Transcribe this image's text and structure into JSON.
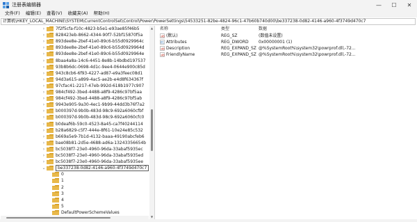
{
  "window": {
    "title": "注册表编辑器"
  },
  "window_controls": {
    "minimize": "—",
    "maximize": "☐",
    "close": "✕"
  },
  "menu": [
    "文件(F)",
    "编辑(E)",
    "查看(V)",
    "收藏夹(A)",
    "帮助(H)"
  ],
  "address": "计算机\\HKEY_LOCAL_MACHINE\\SYSTEM\\CurrentControlSet\\Control\\Power\\PowerSettings\\54533251-82be-4824-96c1-47b60b740d00\\be337238-0d82-4146-a960-4f3749d470c7",
  "tree": [
    {
      "label": "7f2f5cfa-f10c-4823-b5e1-e93ae85f46b5",
      "level": 1
    },
    {
      "label": "828423eb-8662-4344-90f7-52bf15870f5a",
      "level": 1
    },
    {
      "label": "893dee8e-2bef-41e0-89c6-b55d0929964c",
      "level": 1
    },
    {
      "label": "893dee8e-2bef-41e0-89c6-b55d0929964d",
      "level": 1
    },
    {
      "label": "893dee8e-2bef-41e0-89c6-b55d0929964e",
      "level": 1
    },
    {
      "label": "8baa4a8a-14c6-4451-8e8b-14bdbd197537",
      "level": 1
    },
    {
      "label": "93b8b6dc-0698-4d1c-9ee4-0644e900c85d",
      "level": 1
    },
    {
      "label": "943c8cb6-6f93-4227-ad87-e9a3feec08d1",
      "level": 1
    },
    {
      "label": "94d3a615-a899-4ac5-ae2b-e4d8f634367f",
      "level": 1
    },
    {
      "label": "97cfac41-2217-47eb-992d-618b1977c907",
      "level": 1
    },
    {
      "label": "984cf492-3bed-4488-a8f9-4286c97bf5aa",
      "level": 1
    },
    {
      "label": "984cf492-3bed-4488-a8f9-4286c97bf5ab",
      "level": 1
    },
    {
      "label": "9943e905-9a30-4ec1-9b99-44dd3b76f7a2",
      "level": 1
    },
    {
      "label": "b000397d-9b0b-483d-98c9-692a6060cfbf",
      "level": 1
    },
    {
      "label": "b000397d-9b0b-483d-98c9-692a6060cfc0",
      "level": 1
    },
    {
      "label": "b0deaf6b-59c0-4523-8a45-ca7f40244114",
      "level": 1
    },
    {
      "label": "b28a6829-c5f7-444e-8f61-10e24e85c532",
      "level": 1
    },
    {
      "label": "b669a5e9-7b1d-4132-baaa-49190abcfeb6",
      "level": 1
    },
    {
      "label": "bae08b81-2d5e-4688-ad6a-13243356654b",
      "level": 1
    },
    {
      "label": "bc5038f7-23e0-4960-96da-33abaf5935ec",
      "level": 1
    },
    {
      "label": "bc5038f7-23e0-4960-96da-33abaf5935ed",
      "level": 1
    },
    {
      "label": "bc5038f7-23e0-4960-96da-33abaf5935ee",
      "level": 1
    },
    {
      "label": "be337238-0d82-4146-a960-4f3749d470c7",
      "level": 1,
      "expanded": true,
      "selected": true
    },
    {
      "label": "0",
      "level": 2
    },
    {
      "label": "1",
      "level": 2
    },
    {
      "label": "2",
      "level": 2
    },
    {
      "label": "3",
      "level": 2
    },
    {
      "label": "4",
      "level": 2
    },
    {
      "label": "5",
      "level": 2
    },
    {
      "label": "DefaultPowerSchemeValues",
      "level": 2
    }
  ],
  "columns": {
    "name": "名称",
    "type": "类型",
    "data": "数据"
  },
  "values": [
    {
      "name": "(默认)",
      "type": "REG_SZ",
      "data": "(数值未设置)",
      "icon": "string-value-icon"
    },
    {
      "name": "Attributes",
      "type": "REG_DWORD",
      "data": "0x00000001 (1)",
      "icon": "binary-value-icon"
    },
    {
      "name": "Description",
      "type": "REG_EXPAND_SZ",
      "data": "@%SystemRoot%\\system32\\powrprof.dll,-72...",
      "icon": "string-value-icon"
    },
    {
      "name": "FriendlyName",
      "type": "REG_EXPAND_SZ",
      "data": "@%SystemRoot%\\system32\\powrprof.dll,-72...",
      "icon": "string-value-icon"
    }
  ],
  "colors": {
    "folder": "#e8b84a",
    "folder_dark": "#d49b1f",
    "selection_border": "#5a5a5a",
    "string_icon": "#c0392b",
    "binary_icon": "#2a6fb0"
  }
}
